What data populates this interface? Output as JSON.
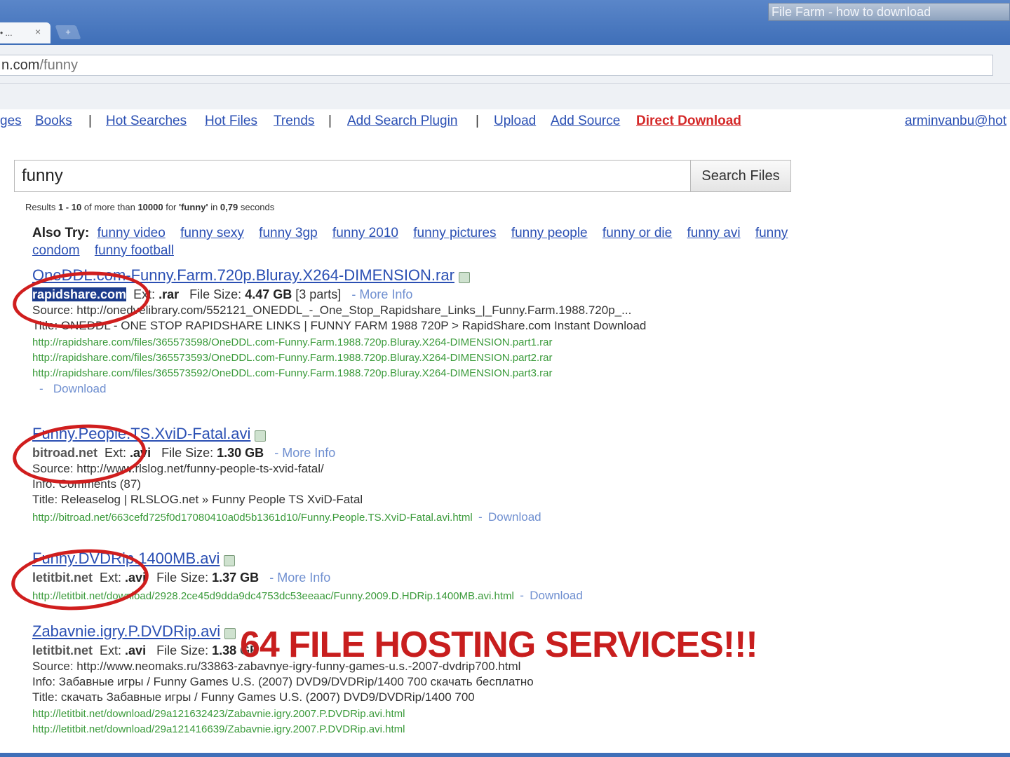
{
  "browser": {
    "tab_label": "• ...",
    "tab_close": "×",
    "new_tab": "+",
    "window_title": "File Farm - how to download",
    "url_host": "n.com",
    "url_path": "/funny"
  },
  "nav": {
    "items": [
      {
        "label": "ges",
        "type": "link"
      },
      {
        "label": "Books",
        "type": "link"
      },
      {
        "label": "|",
        "type": "sep"
      },
      {
        "label": "Hot Searches",
        "type": "link"
      },
      {
        "label": "Hot Files",
        "type": "link"
      },
      {
        "label": "Trends",
        "type": "link"
      },
      {
        "label": "|",
        "type": "sep"
      },
      {
        "label": "Add Search Plugin",
        "type": "link"
      },
      {
        "label": "|",
        "type": "sep"
      },
      {
        "label": "Upload",
        "type": "link"
      },
      {
        "label": "Add Source",
        "type": "link"
      },
      {
        "label": "Direct Download",
        "type": "red"
      }
    ],
    "user": "arminvanbu@hot"
  },
  "search": {
    "query": "funny",
    "button": "Search Files"
  },
  "stats": {
    "prefix": "Results ",
    "range": "1 - 10",
    "mid": " of more than ",
    "count": "10000",
    "for": " for ",
    "term": "'funny'",
    "in": " in ",
    "time": "0,79",
    "suffix": " seconds"
  },
  "also_try": {
    "label": "Also Try:",
    "items": [
      "funny video",
      "funny sexy",
      "funny 3gp",
      "funny 2010",
      "funny pictures",
      "funny people",
      "funny or die",
      "funny avi",
      "funny condom",
      "funny football"
    ]
  },
  "results": [
    {
      "title": "OneDDL.com-Funny.Farm.720p.Bluray.X264-DIMENSION.rar",
      "host": "rapidshare.com",
      "ext_label": "Ext:",
      "ext": ".rar",
      "size_label": "File Size:",
      "size": "4.47 GB",
      "parts": "[3 parts]",
      "more": "More Info",
      "source": "Source: http://onedvelibrary.com/552121_ONEDDL_-_One_Stop_Rapidshare_Links_|_Funny.Farm.1988.720p_...",
      "title_line": "Title: ONEDDL - ONE STOP RAPIDSHARE LINKS | FUNNY FARM 1988 720P > RapidShare.com Instant Download",
      "links": [
        "http://rapidshare.com/files/365573598/OneDDL.com-Funny.Farm.1988.720p.Bluray.X264-DIMENSION.part1.rar",
        "http://rapidshare.com/files/365573593/OneDDL.com-Funny.Farm.1988.720p.Bluray.X264-DIMENSION.part2.rar",
        "http://rapidshare.com/files/365573592/OneDDL.com-Funny.Farm.1988.720p.Bluray.X264-DIMENSION.part3.rar"
      ],
      "download": "Download"
    },
    {
      "title": "Funny.People.TS.XviD-Fatal.avi",
      "host": "bitroad.net",
      "ext_label": "Ext:",
      "ext": ".avi",
      "size_label": "File Size:",
      "size": "1.30 GB",
      "more": "More Info",
      "source": "Source: http://www.rlslog.net/funny-people-ts-xvid-fatal/",
      "info": "Info: Comments (87)",
      "title_line": "Title: Releaselog | RLSLOG.net » Funny People TS XviD-Fatal",
      "link": "http://bitroad.net/663cefd725f0d17080410a0d5b1361d10/Funny.People.TS.XviD-Fatal.avi.html",
      "download": "Download"
    },
    {
      "title": "Funny.DVDRip.1400MB.avi",
      "host": "letitbit.net",
      "ext_label": "Ext:",
      "ext": ".avi",
      "size_label": "File Size:",
      "size": "1.37 GB",
      "more": "More Info",
      "link": "http://letitbit.net/download/2928.2ce45d9dda9dc4753dc53eeaac/Funny.2009.D.HDRip.1400MB.avi.html",
      "download": "Download"
    },
    {
      "title": "Zabavnie.igry.P.DVDRip.avi",
      "host": "letitbit.net",
      "ext_label": "Ext:",
      "ext": ".avi",
      "size_label": "File Size:",
      "size": "1.38 GB",
      "source": "Source: http://www.neomaks.ru/33863-zabavnye-igry-funny-games-u.s.-2007-dvdrip700.html",
      "info": "Info: Забавные игры / Funny Games U.S. (2007) DVD9/DVDRip/1400 700 скачать бесплатно",
      "title_line": "Title: скачать Забавные игры / Funny Games U.S. (2007) DVD9/DVDRip/1400 700",
      "links": [
        "http://letitbit.net/download/29a121632423/Zabavnie.igry.2007.P.DVDRip.avi.html",
        "http://letitbit.net/download/29a121416639/Zabavnie.igry.2007.P.DVDRip.avi.html"
      ]
    }
  ],
  "overlay": "64 FILE HOSTING SERVICES!!!",
  "colors": {
    "link": "#2a4fb3",
    "red": "#d42828",
    "green_url": "#3a9a3a",
    "annotation": "#d01e1e"
  }
}
